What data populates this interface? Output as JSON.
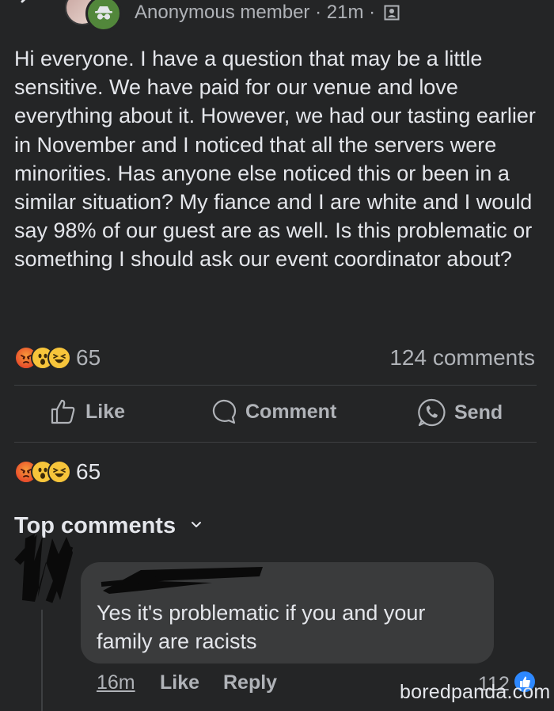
{
  "post": {
    "author": "Anonymous member",
    "time": "21m",
    "separator": "·",
    "privacy_icon": "group-privacy-icon",
    "body": "Hi everyone. I have a question that may be a little sensitive. We have paid for our venue and love everything about it. However, we had our tasting earlier in November and I noticed that all the servers were minorities. Has anyone else noticed this or been in a similar situation? My fiance and I are white and I would say 98% of our guest are as well. Is this problematic or something I should ask our event coordinator about?",
    "reaction_count": "65",
    "comments_count": "124 comments"
  },
  "actions": {
    "like_label": "Like",
    "comment_label": "Comment",
    "send_label": "Send"
  },
  "reactions_summary": {
    "count": "65",
    "emojis": [
      "angry",
      "wow",
      "haha"
    ]
  },
  "top_comments": {
    "label": "Top comments"
  },
  "comment": {
    "text": "Yes it's problematic if you and your family are racists",
    "time": "16m",
    "like_label": "Like",
    "reply_label": "Reply",
    "like_count": "112"
  },
  "watermark": "boredpanda.com",
  "colors": {
    "background": "#242526",
    "bubble": "#3a3b3c",
    "text": "#e4e6eb",
    "muted": "#b0b3b8",
    "like_blue": "#2d88ff"
  }
}
